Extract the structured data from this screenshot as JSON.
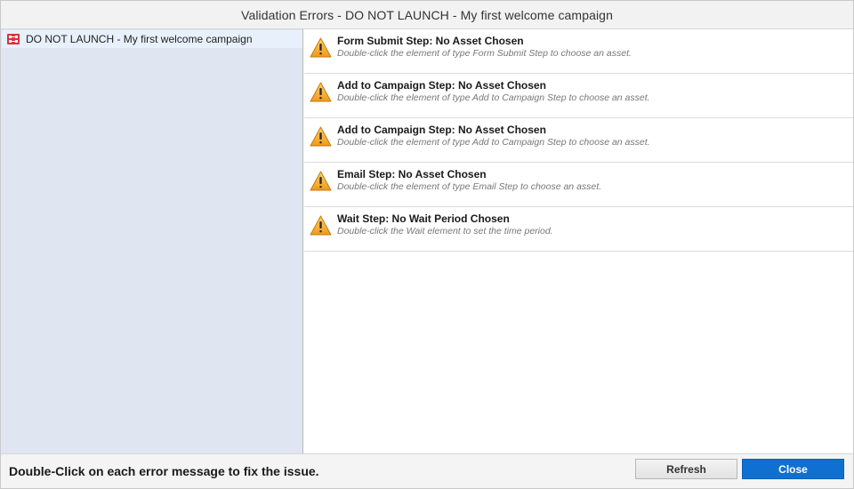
{
  "dialog": {
    "title": "Validation Errors - DO NOT LAUNCH - My first welcome campaign"
  },
  "sidebar": {
    "campaign": {
      "label": "DO NOT LAUNCH - My first welcome campaign",
      "icon": "campaign-icon"
    }
  },
  "errors": [
    {
      "title": "Form Submit Step: No Asset Chosen",
      "description": "Double-click the element of type Form Submit Step to choose an asset.",
      "icon": "warning-icon"
    },
    {
      "title": "Add to Campaign Step: No Asset Chosen",
      "description": "Double-click the element of type Add to Campaign Step to choose an asset.",
      "icon": "warning-icon"
    },
    {
      "title": "Add to Campaign Step: No Asset Chosen",
      "description": "Double-click the element of type Add to Campaign Step to choose an asset.",
      "icon": "warning-icon"
    },
    {
      "title": "Email Step: No Asset Chosen",
      "description": "Double-click the element of type Email Step to choose an asset.",
      "icon": "warning-icon"
    },
    {
      "title": "Wait Step: No Wait Period Chosen",
      "description": "Double-click the Wait element to set the time period.",
      "icon": "warning-icon"
    }
  ],
  "footer": {
    "message": "Double-Click on each error message to fix the issue.",
    "refresh_label": "Refresh",
    "close_label": "Close"
  },
  "colors": {
    "accent": "#0f70d2",
    "warning": "#f5a623",
    "sidebar_bg": "#dfe6f1"
  }
}
